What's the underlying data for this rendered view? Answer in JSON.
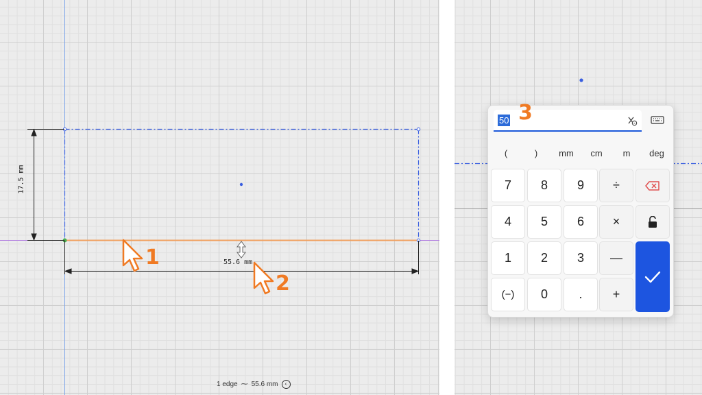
{
  "sketch": {
    "dim_vertical": "17.5 mm",
    "dim_horizontal": "55.6 mm"
  },
  "callouts": [
    "1",
    "2",
    "3"
  ],
  "status_bar": {
    "selection": "1 edge",
    "measurement": "55.6 mm"
  },
  "calculator": {
    "value": "50",
    "unit_buttons": [
      "(",
      ")",
      "mm",
      "cm",
      "m",
      "deg"
    ],
    "keys": [
      {
        "label": "7"
      },
      {
        "label": "8"
      },
      {
        "label": "9"
      },
      {
        "label": "÷"
      },
      {
        "icon": "backspace-icon"
      },
      {
        "label": "4"
      },
      {
        "label": "5"
      },
      {
        "label": "6"
      },
      {
        "label": "×"
      },
      {
        "icon": "lock-icon"
      },
      {
        "label": "1"
      },
      {
        "label": "2"
      },
      {
        "label": "3"
      },
      {
        "label": "—"
      },
      {
        "label": "(−)"
      },
      {
        "label": "0"
      },
      {
        "label": "."
      },
      {
        "label": "+"
      }
    ],
    "confirm_icon": "checkmark-icon"
  },
  "colors": {
    "accent_blue": "#1d55e0",
    "selection_orange": "#f0a060",
    "callout_orange": "#f07a23",
    "sketch_blue": "#3a5fe0",
    "backspace_red": "#e05050"
  }
}
